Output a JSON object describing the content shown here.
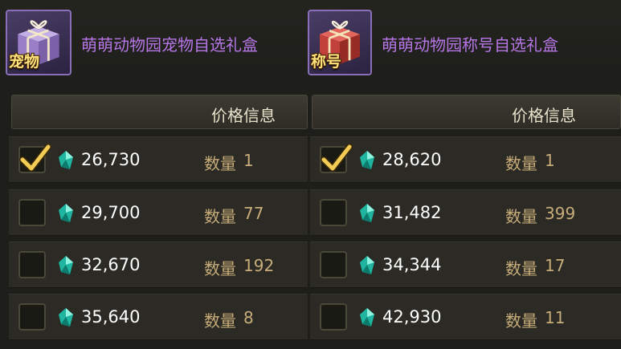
{
  "panels": [
    {
      "icon_tag": "宠物",
      "title": "萌萌动物园宠物自选礼盒",
      "box_color": "#9a7fc7",
      "price_header": "价格信息",
      "qty_label": "数量",
      "rows": [
        {
          "checked": true,
          "price": "26,730",
          "qty": "1"
        },
        {
          "checked": false,
          "price": "29,700",
          "qty": "77"
        },
        {
          "checked": false,
          "price": "32,670",
          "qty": "192"
        },
        {
          "checked": false,
          "price": "35,640",
          "qty": "8"
        }
      ]
    },
    {
      "icon_tag": "称号",
      "title": "萌萌动物园称号自选礼盒",
      "box_color": "#c2413a",
      "price_header": "价格信息",
      "qty_label": "数量",
      "rows": [
        {
          "checked": true,
          "price": "28,620",
          "qty": "1"
        },
        {
          "checked": false,
          "price": "31,482",
          "qty": "399"
        },
        {
          "checked": false,
          "price": "34,344",
          "qty": "17"
        },
        {
          "checked": false,
          "price": "42,930",
          "qty": "11"
        }
      ]
    }
  ]
}
